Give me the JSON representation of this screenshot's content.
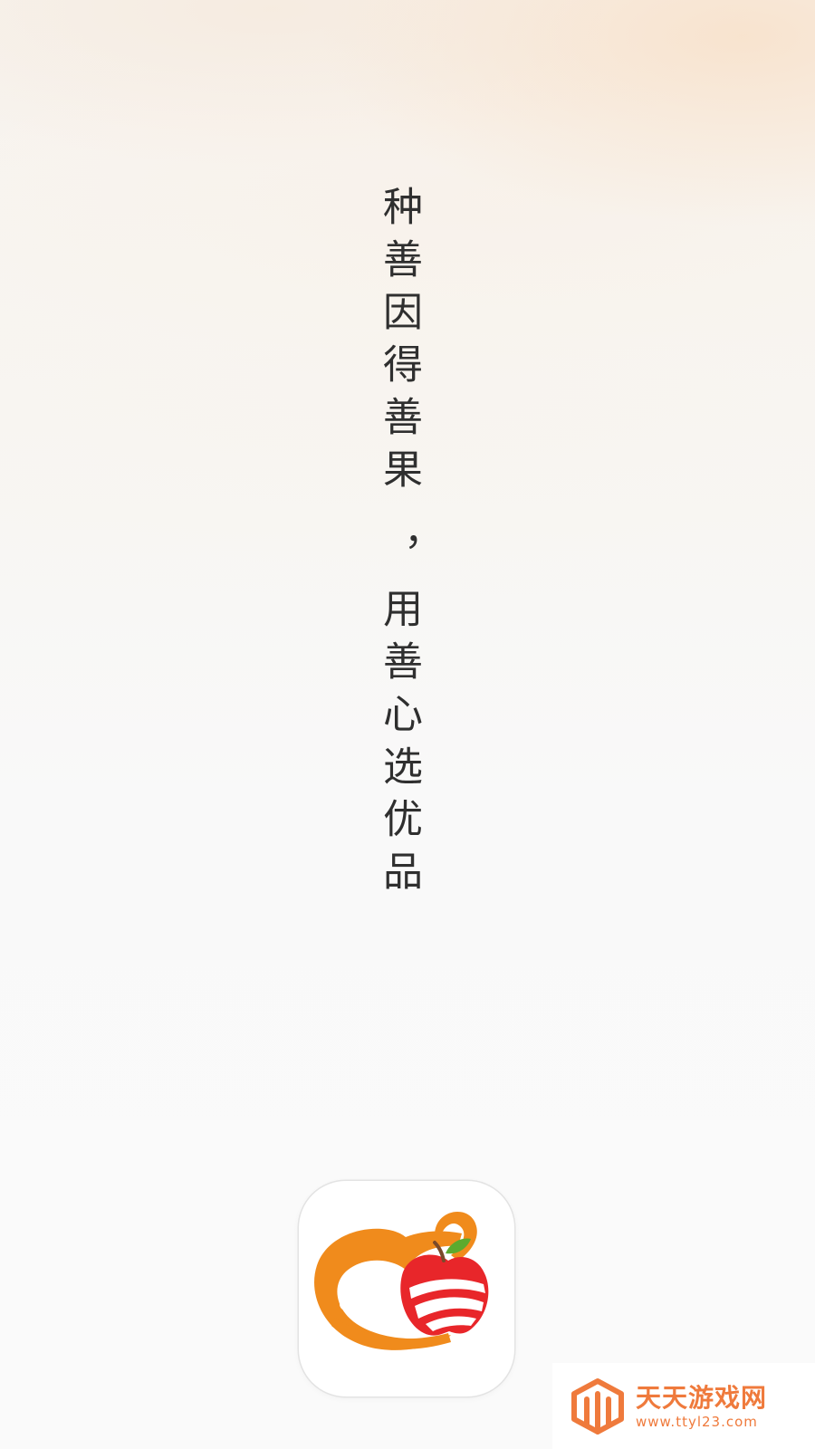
{
  "splash": {
    "slogan_line1": "种善因得善果",
    "slogan_line2": "，用善心选优品"
  },
  "app_icon": {
    "icon": "heart-apple-logo-icon",
    "colors": {
      "heart_orange": "#f08b1c",
      "apple_red": "#e8262a",
      "leaf_green": "#5caa2e",
      "stem_brown": "#7a4a2a"
    }
  },
  "watermark": {
    "icon": "ttyl-cube-logo-icon",
    "title": "天天游戏网",
    "url": "www.ttyl23.com",
    "color": "#ef7a3c"
  }
}
